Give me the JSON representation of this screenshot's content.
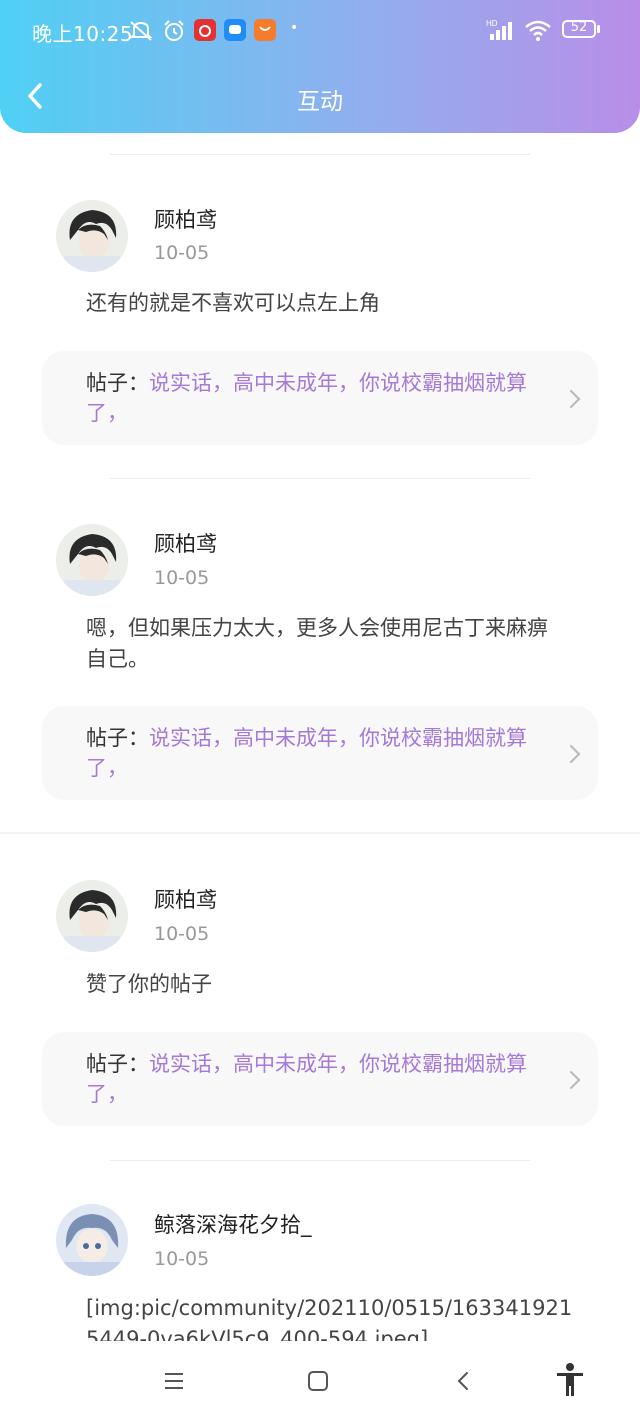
{
  "status_bar": {
    "time": "晚上10:25",
    "battery": "52",
    "network": "HD"
  },
  "header": {
    "title": "互动"
  },
  "colors": {
    "gradient_start": "#4fd0f4",
    "gradient_end": "#b98ee8",
    "post_title": "#a679d9"
  },
  "feed": [
    {
      "user": "顾柏鸢",
      "date": "10-05",
      "message": "还有的就是不喜欢可以点左上角",
      "post_label": "帖子：",
      "post_title": "说实话，高中未成年，你说校霸抽烟就算了，"
    },
    {
      "user": "顾柏鸢",
      "date": "10-05",
      "message": "嗯，但如果压力太大，更多人会使用尼古丁来麻痹自己。",
      "post_label": "帖子：",
      "post_title": "说实话，高中未成年，你说校霸抽烟就算了，"
    },
    {
      "user": "顾柏鸢",
      "date": "10-05",
      "message": "赞了你的帖子",
      "post_label": "帖子：",
      "post_title": "说实话，高中未成年，你说校霸抽烟就算了，"
    },
    {
      "user": "鲸落深海花夕拾_",
      "date": "10-05",
      "message": "[img:pic/community/202110/0515/1633419215449-0va6kVl5c9_400-594.jpeg]"
    }
  ],
  "nav_bar": {
    "icons": [
      "menu-icon",
      "home-icon",
      "back-icon",
      "accessibility-icon"
    ]
  }
}
